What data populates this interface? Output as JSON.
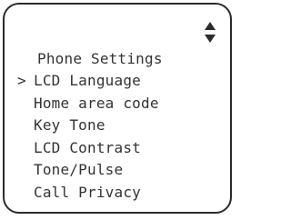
{
  "screen": {
    "title": "Phone Settings",
    "scroll_icon": "up-down-arrows-icon",
    "cursor_glyph": ">",
    "menu": [
      {
        "label": "LCD Language",
        "selected": true
      },
      {
        "label": "Home area code",
        "selected": false
      },
      {
        "label": "Key Tone",
        "selected": false
      },
      {
        "label": "LCD Contrast",
        "selected": false
      },
      {
        "label": "Tone/Pulse",
        "selected": false
      },
      {
        "label": "Call Privacy",
        "selected": false
      }
    ]
  },
  "colors": {
    "border": "#2b2b2b",
    "text": "#333333",
    "background": "#ffffff"
  }
}
